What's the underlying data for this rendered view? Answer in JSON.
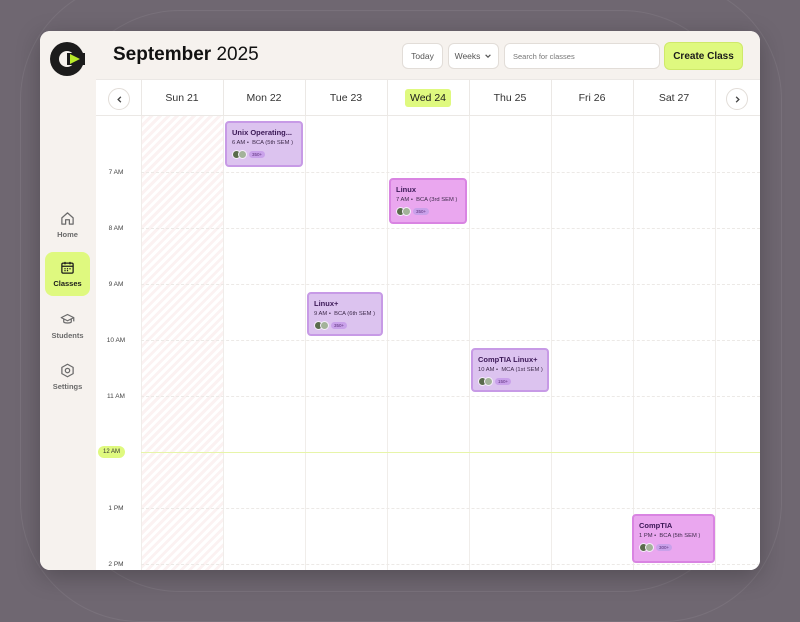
{
  "header": {
    "month": "September",
    "year": "2025",
    "today_label": "Today",
    "view_label": "Weeks",
    "search_placeholder": "Search for classes",
    "create_label": "Create Class"
  },
  "sidebar": {
    "items": [
      {
        "label": "Home",
        "icon": "home-icon",
        "active": false
      },
      {
        "label": "Classes",
        "icon": "calendar-icon",
        "active": true
      },
      {
        "label": "Students",
        "icon": "graduation-cap-icon",
        "active": false
      },
      {
        "label": "Settings",
        "icon": "settings-icon",
        "active": false
      }
    ]
  },
  "days": [
    {
      "label": "Sun 21"
    },
    {
      "label": "Mon 22"
    },
    {
      "label": "Tue 23"
    },
    {
      "label": "Wed 24",
      "today": true
    },
    {
      "label": "Thu 25"
    },
    {
      "label": "Fri 26"
    },
    {
      "label": "Sat 27"
    }
  ],
  "times": [
    "7 AM",
    "8 AM",
    "9 AM",
    "10 AM",
    "11 AM",
    "12 AM",
    "1 PM",
    "2 PM"
  ],
  "current_time_label": "12 AM",
  "events": [
    {
      "title": "Unix Operating...",
      "time": "6 AM",
      "group": "BCA (5th SEM )",
      "count": "350+",
      "style": "lav"
    },
    {
      "title": "Linux",
      "time": "7 AM",
      "group": "BCA (3rd SEM )",
      "count": "350+",
      "style": "pink"
    },
    {
      "title": "Linux+",
      "time": "9 AM",
      "group": "BCA (6th SEM )",
      "count": "350+",
      "style": "lav"
    },
    {
      "title": "CompTIA Linux+",
      "time": "10 AM",
      "group": "MCA (1st SEM )",
      "count": "150+",
      "style": "lav"
    },
    {
      "title": "CompTIA",
      "time": "1 PM",
      "group": "BCA (5th SEM )",
      "count": "300+",
      "style": "pink"
    }
  ],
  "colors": {
    "accent": "#dff97f",
    "event_lavender": "#dcc3ef",
    "event_pink": "#eaa7ef",
    "logo_dark": "#1c1c1c",
    "logo_accent": "#b8ea2a"
  }
}
